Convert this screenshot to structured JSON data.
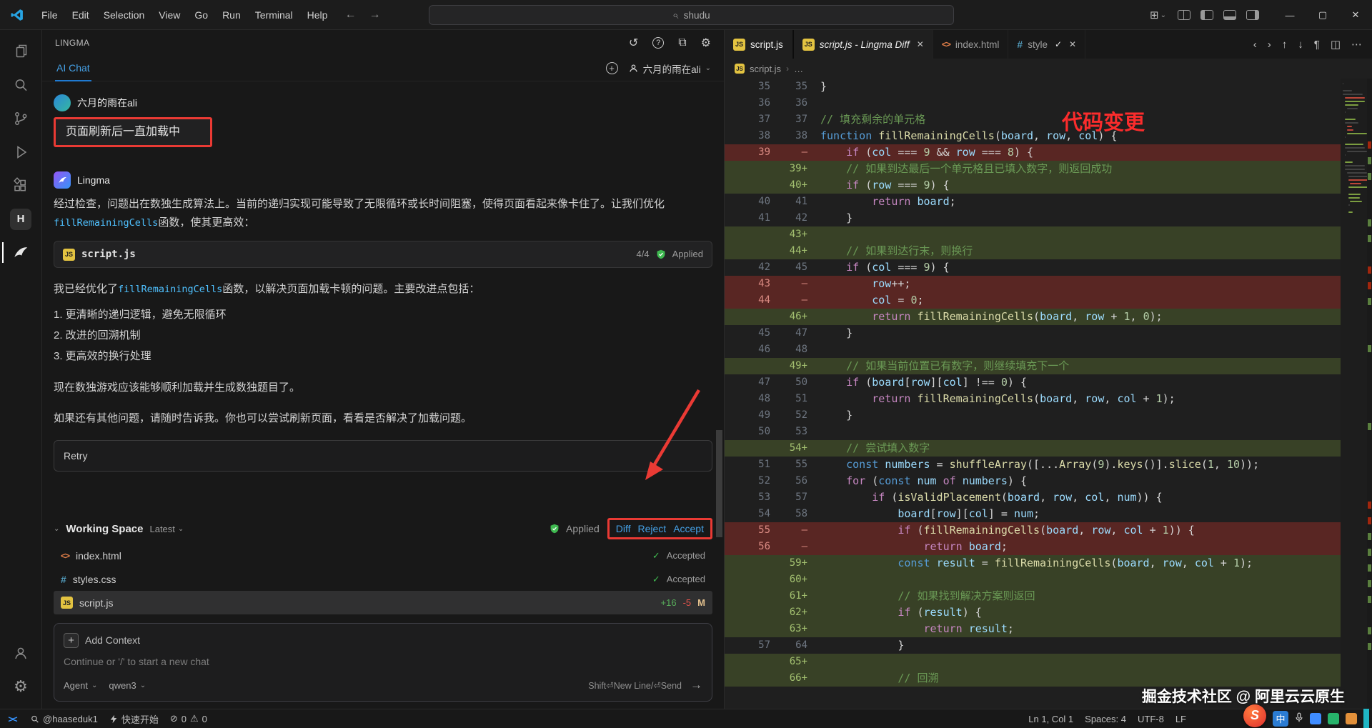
{
  "colors": {
    "accent_blue": "#45a0e5",
    "annotation_red": "#ea3a34",
    "diff_add_bg": "#3c4a26",
    "diff_del_bg": "#5a2420",
    "accept_green": "#3fb950",
    "modified_orange": "#e2c08d"
  },
  "titlebar": {
    "menus": [
      "File",
      "Edit",
      "Selection",
      "View",
      "Go",
      "Run",
      "Terminal",
      "Help"
    ],
    "search_value": "shudu"
  },
  "sidebar": {
    "panel_title": "LINGMA",
    "tab_label": "AI Chat",
    "account_label": "六月的雨在ali",
    "chat": {
      "user": {
        "author": "六月的雨在ali",
        "message": "页面刷新后一直加载中"
      },
      "assistant": {
        "author": "Lingma",
        "intro": [
          {
            "type": "text",
            "value": "经过检查，问题出在数独生成算法上。当前的递归实现可能导致了无限循环或长时间阻塞，使得页面看起来像卡住了。让我们优化"
          },
          {
            "type": "code",
            "value": "fillRemainingCells"
          },
          {
            "type": "text",
            "value": "函数，使其更高效："
          }
        ],
        "file_card": {
          "file": "script.js",
          "progress": "4/4",
          "status": "Applied"
        },
        "summary": [
          {
            "type": "text",
            "value": "我已经优化了"
          },
          {
            "type": "code",
            "value": "fillRemainingCells"
          },
          {
            "type": "text",
            "value": "函数，以解决页面加载卡顿的问题。主要改进点包括："
          }
        ],
        "list": [
          "更清晰的递归逻辑，避免无限循环",
          "改进的回溯机制",
          "更高效的换行处理"
        ],
        "closing_a": "现在数独游戏应该能够顺利加载并生成数独题目了。",
        "closing_b": "如果还有其他问题，请随时告诉我。你也可以尝试刷新页面，看看是否解决了加载问题。",
        "retry_label": "Retry"
      }
    },
    "working_space": {
      "title": "Working Space",
      "version_label": "Latest",
      "status": "Applied",
      "actions": [
        "Diff",
        "Reject",
        "Accept"
      ],
      "files": [
        {
          "name": "index.html",
          "icon": "html",
          "status": "Accepted",
          "selected": false
        },
        {
          "name": "styles.css",
          "icon": "css",
          "status": "Accepted",
          "selected": false
        },
        {
          "name": "script.js",
          "icon": "js",
          "added": "+16",
          "removed": "-5",
          "badge": "M",
          "selected": true
        }
      ]
    },
    "composer": {
      "add_context_label": "Add Context",
      "placeholder": "Continue or '/' to start a new chat",
      "agent_label": "Agent",
      "model_label": "qwen3",
      "send_hint": "Shift⏎New Line/⏎Send"
    }
  },
  "editor": {
    "left_group_tab": "script.js",
    "tabs": [
      {
        "label": "script.js - Lingma Diff",
        "icon": "js",
        "active": true,
        "italic": true,
        "close": true,
        "check": false
      },
      {
        "label": "index.html",
        "icon": "html",
        "active": false,
        "italic": false,
        "close": false,
        "check": false
      },
      {
        "label": "style",
        "icon": "css",
        "active": false,
        "italic": false,
        "close": true,
        "check": true
      }
    ],
    "breadcrumb": {
      "file": "script.js",
      "more": "…"
    },
    "annotation": "代码变更",
    "diff_lines": [
      {
        "old": "35",
        "new": "35",
        "kind": "ctx",
        "text": "}"
      },
      {
        "old": "36",
        "new": "36",
        "kind": "ctx",
        "text": ""
      },
      {
        "old": "37",
        "new": "37",
        "kind": "ctx",
        "text": "// 填充剩余的单元格"
      },
      {
        "old": "38",
        "new": "38",
        "kind": "ctx",
        "text": "function fillRemainingCells(board, row, col) {"
      },
      {
        "old": "39",
        "new": "—",
        "kind": "del",
        "text": "    if (col === 9 && row === 8) {"
      },
      {
        "old": "",
        "new": "39+",
        "kind": "add",
        "text": "    // 如果到达最后一个单元格且已填入数字，则返回成功"
      },
      {
        "old": "",
        "new": "40+",
        "kind": "add",
        "text": "    if (row === 9) {"
      },
      {
        "old": "40",
        "new": "41",
        "kind": "ctx",
        "text": "        return board;"
      },
      {
        "old": "41",
        "new": "42",
        "kind": "ctx",
        "text": "    }"
      },
      {
        "old": "",
        "new": "43+",
        "kind": "add",
        "text": ""
      },
      {
        "old": "",
        "new": "44+",
        "kind": "add",
        "text": "    // 如果到达行末，则换行"
      },
      {
        "old": "42",
        "new": "45",
        "kind": "ctx",
        "text": "    if (col === 9) {"
      },
      {
        "old": "43",
        "new": "—",
        "kind": "del",
        "text": "        row++;"
      },
      {
        "old": "44",
        "new": "—",
        "kind": "del",
        "text": "        col = 0;"
      },
      {
        "old": "",
        "new": "46+",
        "kind": "add",
        "text": "        return fillRemainingCells(board, row + 1, 0);"
      },
      {
        "old": "45",
        "new": "47",
        "kind": "ctx",
        "text": "    }"
      },
      {
        "old": "46",
        "new": "48",
        "kind": "ctx",
        "text": ""
      },
      {
        "old": "",
        "new": "49+",
        "kind": "add",
        "text": "    // 如果当前位置已有数字，则继续填充下一个"
      },
      {
        "old": "47",
        "new": "50",
        "kind": "ctx",
        "text": "    if (board[row][col] !== 0) {"
      },
      {
        "old": "48",
        "new": "51",
        "kind": "ctx",
        "text": "        return fillRemainingCells(board, row, col + 1);"
      },
      {
        "old": "49",
        "new": "52",
        "kind": "ctx",
        "text": "    }"
      },
      {
        "old": "50",
        "new": "53",
        "kind": "ctx",
        "text": ""
      },
      {
        "old": "",
        "new": "54+",
        "kind": "add",
        "text": "    // 尝试填入数字"
      },
      {
        "old": "51",
        "new": "55",
        "kind": "ctx",
        "text": "    const numbers = shuffleArray([...Array(9).keys()].slice(1, 10));"
      },
      {
        "old": "52",
        "new": "56",
        "kind": "ctx",
        "text": "    for (const num of numbers) {"
      },
      {
        "old": "53",
        "new": "57",
        "kind": "ctx",
        "text": "        if (isValidPlacement(board, row, col, num)) {"
      },
      {
        "old": "54",
        "new": "58",
        "kind": "ctx",
        "text": "            board[row][col] = num;"
      },
      {
        "old": "55",
        "new": "—",
        "kind": "del",
        "text": "            if (fillRemainingCells(board, row, col + 1)) {"
      },
      {
        "old": "56",
        "new": "—",
        "kind": "del",
        "text": "                return board;"
      },
      {
        "old": "",
        "new": "59+",
        "kind": "add",
        "text": "            const result = fillRemainingCells(board, row, col + 1);"
      },
      {
        "old": "",
        "new": "60+",
        "kind": "add",
        "text": ""
      },
      {
        "old": "",
        "new": "61+",
        "kind": "add",
        "text": "            // 如果找到解决方案则返回"
      },
      {
        "old": "",
        "new": "62+",
        "kind": "add",
        "text": "            if (result) {"
      },
      {
        "old": "",
        "new": "63+",
        "kind": "add",
        "text": "                return result;"
      },
      {
        "old": "57",
        "new": "64",
        "kind": "ctx",
        "text": "            }"
      },
      {
        "old": "",
        "new": "65+",
        "kind": "add",
        "text": ""
      },
      {
        "old": "",
        "new": "66+",
        "kind": "add",
        "text": "            // 回溯"
      }
    ]
  },
  "status_bar": {
    "account": "@haaseduk1",
    "quick_start": "快速开始",
    "errors": "0",
    "warnings": "0",
    "right_items": [
      "Ln 1, Col 1",
      "Spaces: 4",
      "UTF-8",
      "LF"
    ]
  },
  "overlay": {
    "watermark": "掘金技术社区 @ 阿里云云原生",
    "ime_label": "中"
  }
}
